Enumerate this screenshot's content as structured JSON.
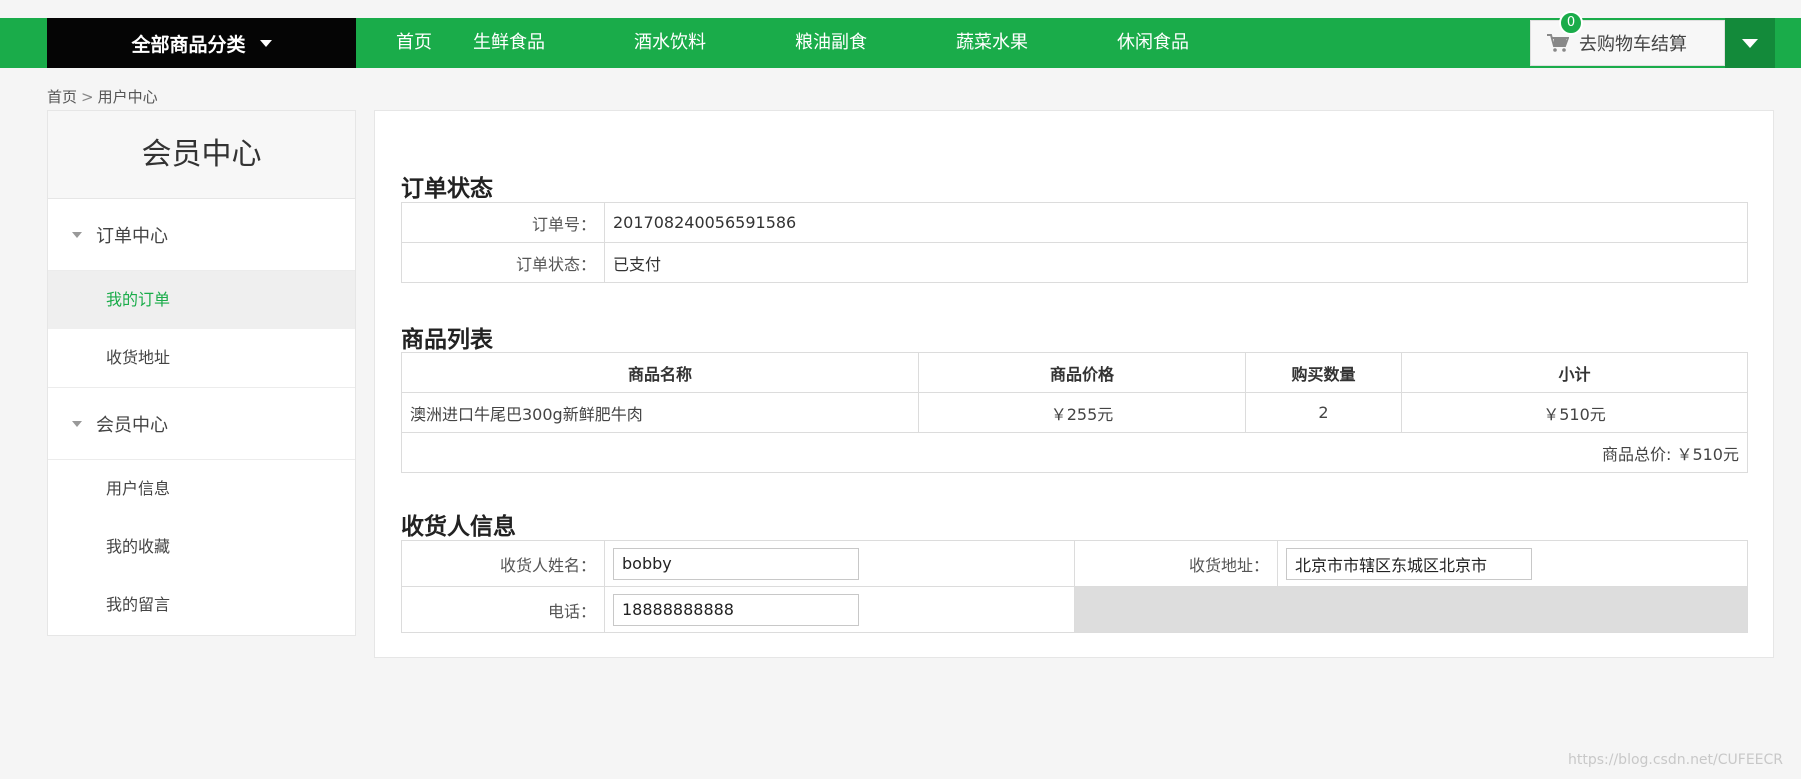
{
  "header": {
    "all_categories": "全部商品分类",
    "nav": [
      "首页",
      "生鲜食品",
      "酒水饮料",
      "粮油副食",
      "蔬菜水果",
      "休闲食品"
    ],
    "cart_count": "0",
    "cart_label": "去购物车结算"
  },
  "breadcrumb": {
    "home": "首页",
    "sep": ">",
    "current": "用户中心"
  },
  "sidebar": {
    "title": "会员中心",
    "group1": "订单中心",
    "group1_items": [
      "我的订单",
      "收货地址"
    ],
    "group2": "会员中心",
    "group2_items": [
      "用户信息",
      "我的收藏",
      "我的留言"
    ]
  },
  "order_status": {
    "title": "订单状态",
    "order_no_label": "订单号：",
    "order_no": "201708240056591586",
    "status_label": "订单状态：",
    "status": "已支付"
  },
  "goods": {
    "title": "商品列表",
    "headers": [
      "商品名称",
      "商品价格",
      "购买数量",
      "小计"
    ],
    "rows": [
      {
        "name": "澳洲进口牛尾巴300g新鲜肥牛肉",
        "price": "￥255元",
        "qty": "2",
        "subtotal": "￥510元"
      }
    ],
    "total": "商品总价: ￥510元"
  },
  "receiver": {
    "title": "收货人信息",
    "name_label": "收货人姓名：",
    "name": "bobby",
    "address_label": "收货地址：",
    "address": "北京市市辖区东城区北京市",
    "phone_label": "电话：",
    "phone": "18888888888"
  },
  "watermark": "https://blog.csdn.net/CUFEECR",
  "colors": {
    "brand_green": "#1aac4a",
    "dark": "#050505"
  }
}
